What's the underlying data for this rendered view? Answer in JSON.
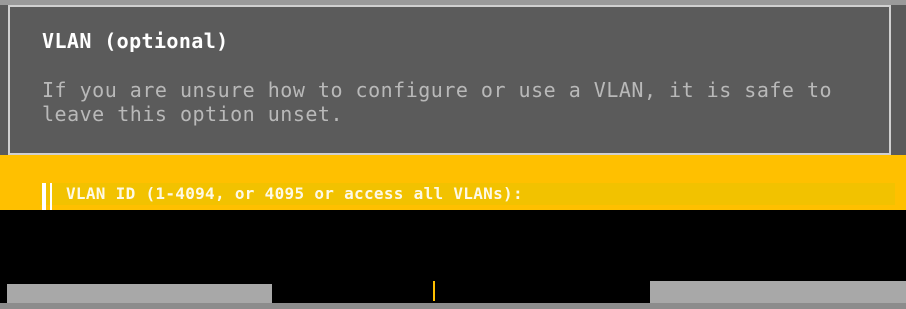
{
  "dialog": {
    "title": "VLAN (optional)",
    "help_text": "If you are unsure how to configure or use a VLAN, it is safe to\nleave this option unset."
  },
  "vlan_field": {
    "label": "VLAN ID (1-4094, or 4095 or access all VLANs):",
    "value": ""
  },
  "colors": {
    "dialog_bg": "#5b5b5b",
    "accent_yellow": "#ffc000",
    "title_text": "#ffffff",
    "help_text": "#b9b9b9"
  }
}
